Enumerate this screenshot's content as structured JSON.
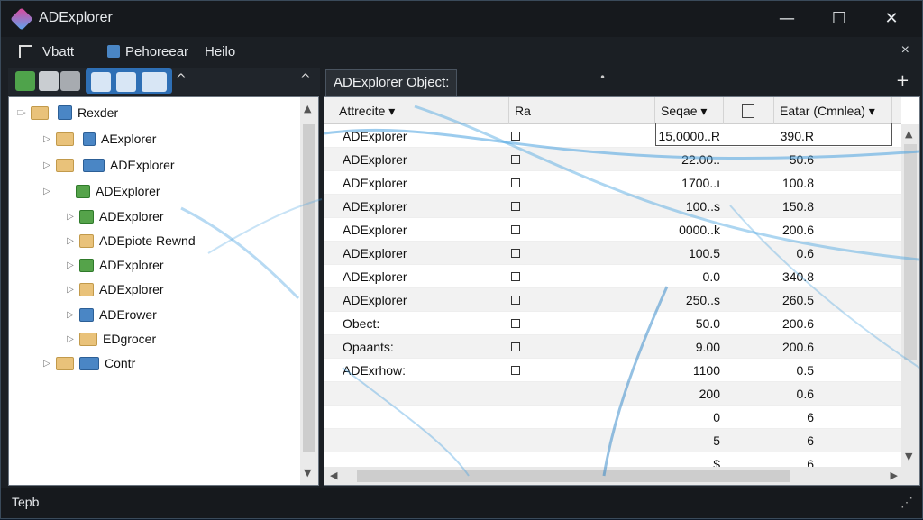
{
  "app": {
    "title": "ADExplorer"
  },
  "window_controls": {
    "minimize": "—",
    "maximize": "☐",
    "close": "✕"
  },
  "menu": {
    "items": [
      {
        "icon": "list-icon",
        "label": "Vbatt"
      },
      {
        "icon": "network-icon",
        "label": "Pehoreear"
      },
      {
        "icon": "",
        "label": "Heilo"
      }
    ],
    "close": "×"
  },
  "toolbar": {
    "collapse": "^",
    "panel_collapse": "^"
  },
  "tree": {
    "items": [
      {
        "label": "Rexder",
        "icon": "book-icon",
        "expander": "□-"
      },
      {
        "label": "AExplorer",
        "icon": "user-icon",
        "expander": "▷"
      },
      {
        "label": "ADExplorer",
        "icon": "folder-icon",
        "expander": "▷"
      },
      {
        "label": "ADExplorer",
        "icon": "green-folder-icon",
        "expander": "▷"
      },
      {
        "label": "ADExplorer",
        "icon": "green-folder-icon",
        "expander": "▷"
      },
      {
        "label": "ADEpiote Rewnd",
        "icon": "folder-icon",
        "expander": "▷"
      },
      {
        "label": "ADExplorer",
        "icon": "green-folder-icon",
        "expander": "▷"
      },
      {
        "label": "ADExplorer",
        "icon": "folder-icon",
        "expander": "▷"
      },
      {
        "label": "ADErower",
        "icon": "blue-folder-icon",
        "expander": "▷"
      },
      {
        "label": "EDgrocer",
        "icon": "folder-icon",
        "expander": "▷"
      },
      {
        "label": "Contr",
        "icon": "grid-icon",
        "expander": "▷"
      }
    ]
  },
  "tab": {
    "label": "ADExplorer Object:",
    "add": "+",
    "dot": "•"
  },
  "grid": {
    "columns": [
      "Attrecite ▾",
      "Ra",
      "Seqae ▾",
      "",
      "Eatar (Cmnlea) ▾"
    ],
    "rows": [
      {
        "name": "ADExplorer",
        "checkbox": true,
        "value": "15,0000..R",
        "value2": "390.R"
      },
      {
        "name": "ADExplorer",
        "checkbox": true,
        "value": "22.00..",
        "value2": "50.6"
      },
      {
        "name": "ADExplorer",
        "checkbox": true,
        "value": "1700..ı",
        "value2": "100.8"
      },
      {
        "name": "ADExplorer",
        "checkbox": true,
        "value": "100..s",
        "value2": "150.8"
      },
      {
        "name": "ADExplorer",
        "checkbox": true,
        "value": "0000..k",
        "value2": "200.6"
      },
      {
        "name": "ADExplorer",
        "checkbox": true,
        "value": "100.5",
        "value2": "0.6"
      },
      {
        "name": "ADExplorer",
        "checkbox": true,
        "value": "0.0",
        "value2": "340.8"
      },
      {
        "name": "ADExplorer",
        "checkbox": true,
        "value": "250..s",
        "value2": "260.5"
      },
      {
        "name": "Obect:",
        "checkbox": true,
        "value": "50.0",
        "value2": "200.6"
      },
      {
        "name": "Opaants:",
        "checkbox": true,
        "value": "9.00",
        "value2": "200.6"
      },
      {
        "name": "ADExrhow:",
        "checkbox": true,
        "value": "1100",
        "value2": "0.5"
      },
      {
        "name": "",
        "checkbox": false,
        "value": "200",
        "value2": "0.6"
      },
      {
        "name": "",
        "checkbox": false,
        "value": "0",
        "value2": "6"
      },
      {
        "name": "",
        "checkbox": false,
        "value": "5",
        "value2": "6"
      },
      {
        "name": "",
        "checkbox": false,
        "value": "$",
        "value2": "6"
      }
    ]
  },
  "status": {
    "text": "Tepb",
    "grip": "⋰"
  },
  "colors": {
    "accent": "#2e6fb5",
    "title_bg": "#16191d",
    "panel_bg": "#ffffff",
    "streak": "#4aa3e0"
  }
}
